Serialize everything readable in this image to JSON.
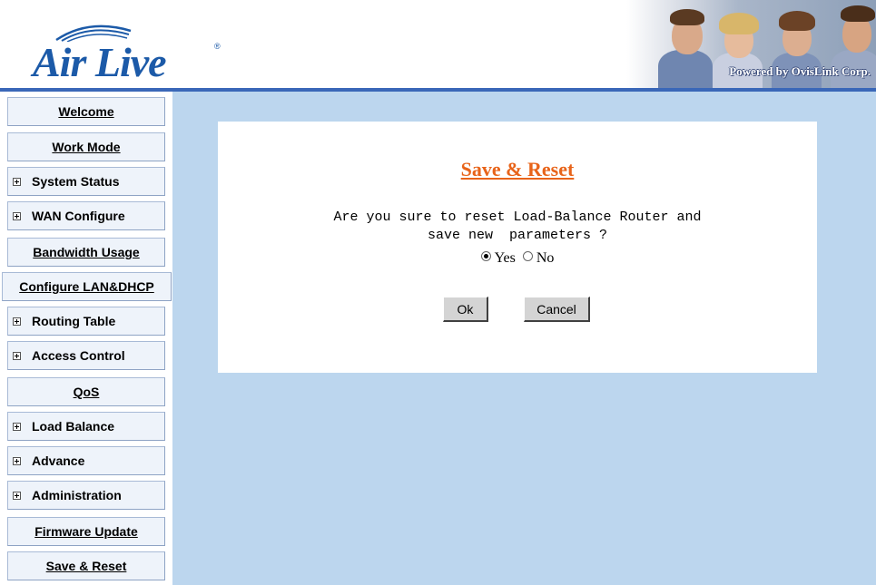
{
  "header": {
    "logo_text": "Air Live",
    "logo_mark": "®",
    "banner_text": "Powered by OvisLink Corp."
  },
  "sidebar": {
    "items": [
      {
        "label": "Welcome",
        "expandable": false
      },
      {
        "label": "Work Mode",
        "expandable": false
      },
      {
        "label": "System Status",
        "expandable": true
      },
      {
        "label": "WAN Configure",
        "expandable": true
      },
      {
        "label": "Bandwidth Usage",
        "expandable": false
      },
      {
        "label": "Configure LAN&DHCP",
        "expandable": false
      },
      {
        "label": "Routing Table",
        "expandable": true
      },
      {
        "label": "Access Control",
        "expandable": true
      },
      {
        "label": "QoS",
        "expandable": false
      },
      {
        "label": "Load Balance",
        "expandable": true
      },
      {
        "label": "Advance",
        "expandable": true
      },
      {
        "label": "Administration",
        "expandable": true
      },
      {
        "label": "Firmware Update",
        "expandable": false
      },
      {
        "label": "Save & Reset",
        "expandable": false
      }
    ]
  },
  "main": {
    "title": "Save & Reset",
    "question_line1": "Are you sure to reset Load-Balance Router and",
    "question_line2": "save new  parameters ?",
    "options": {
      "yes_label": "Yes",
      "no_label": "No",
      "selected": "Yes"
    },
    "ok_label": "Ok",
    "cancel_label": "Cancel"
  },
  "colors": {
    "accent_blue": "#3a67b8",
    "content_bg": "#bcd6ee",
    "title_orange": "#e8641a",
    "logo_blue": "#1c5aa8"
  },
  "icons": {
    "expand": "plus-box-icon",
    "radio": "radio-icon"
  }
}
